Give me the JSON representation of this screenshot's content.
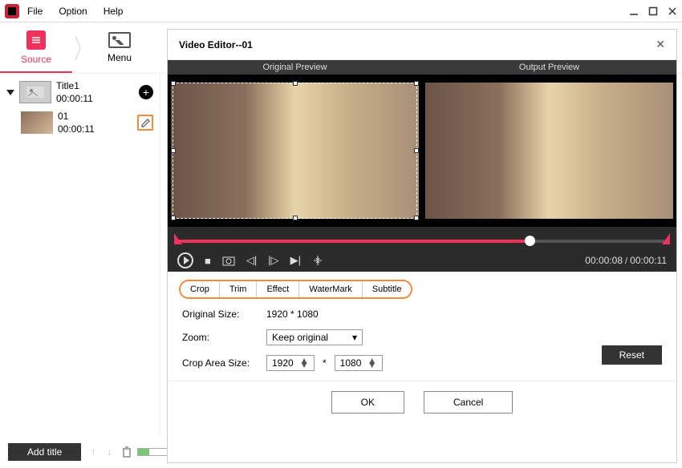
{
  "menubar": {
    "file": "File",
    "option": "Option",
    "help": "Help"
  },
  "topnav": {
    "source": "Source",
    "menu": "Menu"
  },
  "sidebar": {
    "title1": {
      "name": "Title1",
      "duration": "00:00:11"
    },
    "clip1": {
      "name": "01",
      "duration": "00:00:11"
    }
  },
  "bottom": {
    "add_title": "Add title"
  },
  "editor": {
    "title": "Video Editor--01",
    "preview": {
      "original": "Original Preview",
      "output": "Output Preview"
    },
    "time": {
      "current": "00:00:08",
      "total": "00:00:11"
    },
    "tabs": {
      "crop": "Crop",
      "trim": "Trim",
      "effect": "Effect",
      "watermark": "WaterMark",
      "subtitle": "Subtitle"
    },
    "settings": {
      "original_size_label": "Original Size:",
      "original_size_value": "1920 * 1080",
      "zoom_label": "Zoom:",
      "zoom_value": "Keep original",
      "crop_area_label": "Crop Area Size:",
      "crop_w": "1920",
      "crop_h": "1080",
      "times": "*",
      "reset": "Reset"
    },
    "buttons": {
      "ok": "OK",
      "cancel": "Cancel"
    }
  }
}
